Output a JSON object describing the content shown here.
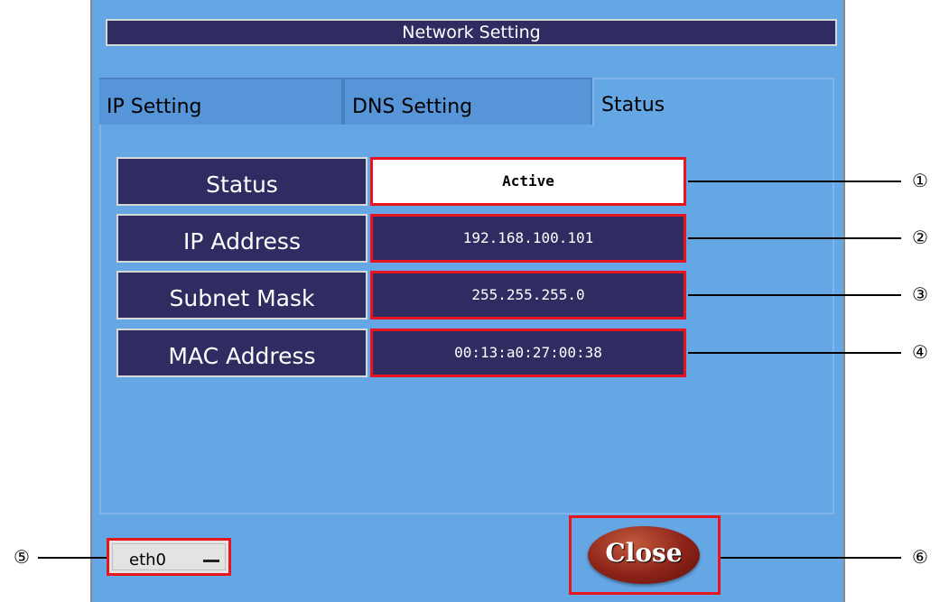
{
  "window": {
    "title": "Network Setting"
  },
  "tabs": [
    {
      "label": "IP Setting"
    },
    {
      "label": "DNS Setting"
    },
    {
      "label": "Status"
    }
  ],
  "status": {
    "rows": [
      {
        "label": "Status",
        "value": "Active"
      },
      {
        "label": "IP Address",
        "value": "192.168.100.101"
      },
      {
        "label": "Subnet Mask",
        "value": "255.255.255.0"
      },
      {
        "label": "MAC Address",
        "value": "00:13:a0:27:00:38"
      }
    ]
  },
  "interface_select": {
    "value": "eth0"
  },
  "close_button": {
    "label": "Close"
  },
  "callouts": [
    "①",
    "②",
    "③",
    "④",
    "⑤",
    "⑥"
  ],
  "colors": {
    "panel": "#65a6e5",
    "box": "#2f2c62",
    "highlight": "#e8141e",
    "close": "#8d2318"
  }
}
